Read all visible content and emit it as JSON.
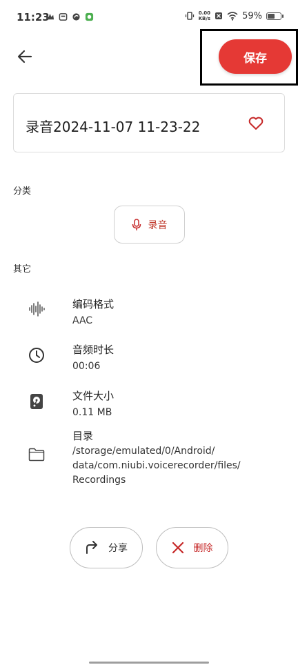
{
  "status_bar": {
    "time": "11:23",
    "net_speed_value": "0.00",
    "net_speed_unit": "KB/s",
    "battery_percent": "59%",
    "battery_level": 0.59
  },
  "header": {
    "back_icon": "arrow-left-icon",
    "save_label": "保存"
  },
  "recording": {
    "title": "录音2024-11-07 11-23-22",
    "favorite_icon": "heart-outline-icon"
  },
  "category": {
    "section_label": "分类",
    "chip_label": "录音",
    "chip_icon": "microphone-icon"
  },
  "other": {
    "section_label": "其它",
    "items": [
      {
        "icon": "waveform-icon",
        "label": "编码格式",
        "value": "AAC"
      },
      {
        "icon": "clock-icon",
        "label": "音频时长",
        "value": "00:06"
      },
      {
        "icon": "disk-icon",
        "label": "文件大小",
        "value": "0.11 MB"
      },
      {
        "icon": "folder-icon",
        "label": "目录",
        "value": "/storage/emulated/0/Android/\ndata/com.niubi.voicerecorder/files/\nRecordings"
      }
    ]
  },
  "actions": {
    "share_label": "分享",
    "delete_label": "删除"
  },
  "colors": {
    "accent": "#e53935",
    "accent_text": "#c62828"
  }
}
